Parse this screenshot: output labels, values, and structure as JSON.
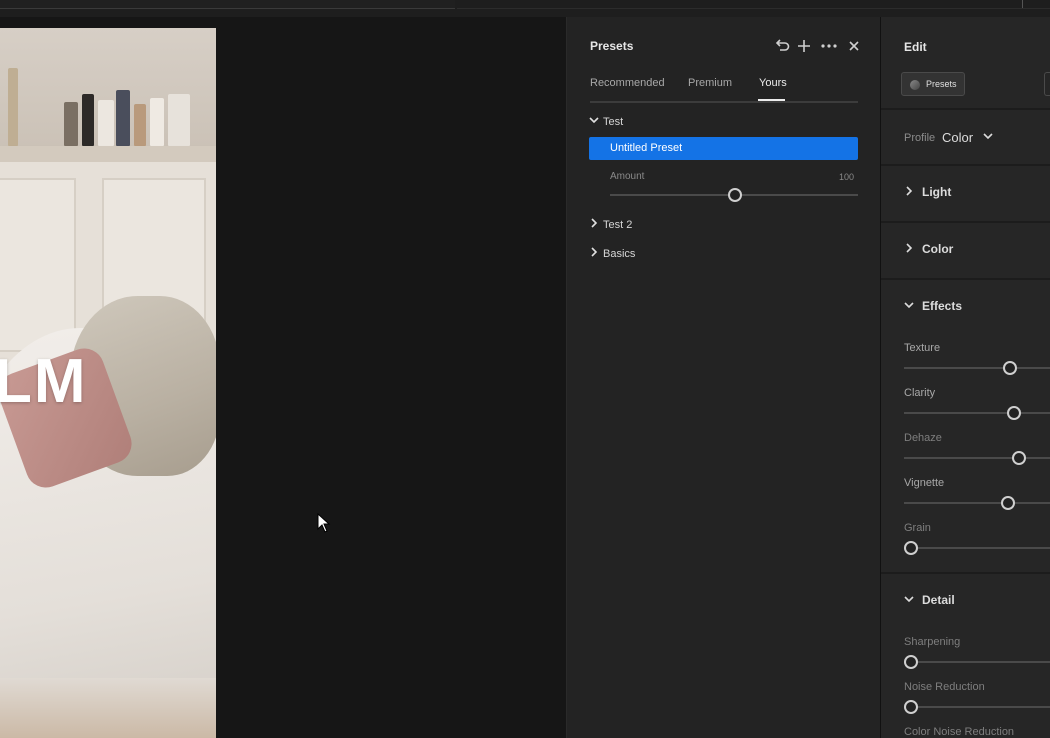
{
  "photo": {
    "overlay_text": "LM"
  },
  "presets_panel": {
    "title": "Presets",
    "header_icons": [
      "undo-icon",
      "plus-icon",
      "more-icon",
      "close-icon"
    ],
    "tabs": [
      {
        "label": "Recommended",
        "active": false
      },
      {
        "label": "Premium",
        "active": false
      },
      {
        "label": "Yours",
        "active": true
      }
    ],
    "groups": [
      {
        "label": "Test",
        "expanded": true
      },
      {
        "label": "Test 2",
        "expanded": false
      },
      {
        "label": "Basics",
        "expanded": false
      }
    ],
    "selected_preset": "Untitled Preset",
    "amount": {
      "label": "Amount",
      "value": "100",
      "fraction": 0.47
    }
  },
  "edit_panel": {
    "title": "Edit",
    "presets_button": "Presets",
    "profile": {
      "label": "Profile",
      "value": "Color"
    },
    "sections": [
      {
        "label": "Light",
        "expanded": false
      },
      {
        "label": "Color",
        "expanded": false
      },
      {
        "label": "Effects",
        "expanded": true
      },
      {
        "label": "Detail",
        "expanded": true
      }
    ],
    "effects_sliders": [
      {
        "label": "Texture",
        "fraction": 0.62
      },
      {
        "label": "Clarity",
        "fraction": 0.65
      },
      {
        "label": "Dehaze",
        "fraction": 0.68
      },
      {
        "label": "Vignette",
        "fraction": 0.6
      },
      {
        "label": "Grain",
        "fraction": 0.0
      }
    ],
    "detail_sliders": [
      {
        "label": "Sharpening",
        "fraction": 0.0
      },
      {
        "label": "Noise Reduction",
        "fraction": 0.0
      },
      {
        "label": "Color Noise Reduction",
        "fraction": 0.0
      }
    ]
  },
  "colors": {
    "accent": "#1473e6",
    "panel": "#232323",
    "background": "#161616"
  }
}
